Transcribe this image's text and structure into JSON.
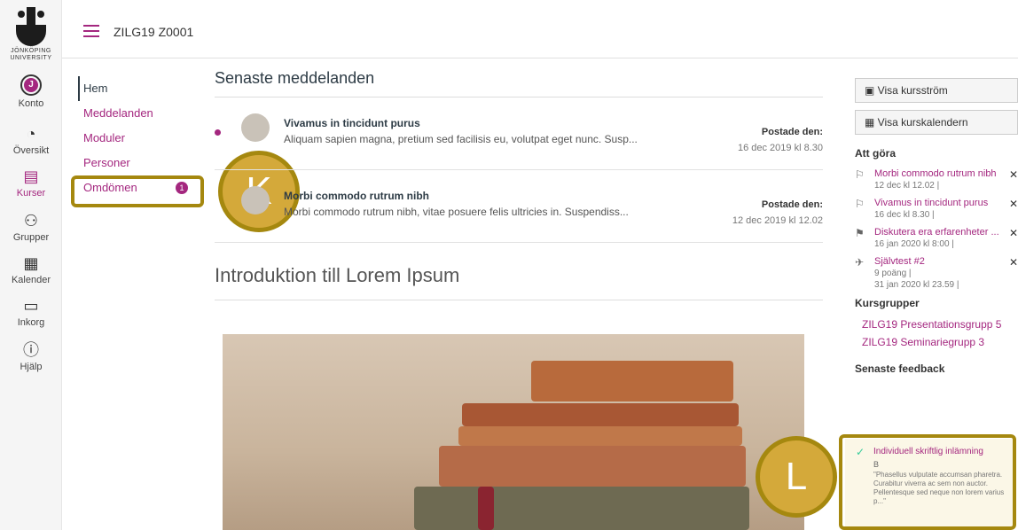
{
  "brand": {
    "logo_text": "JÖNKÖPING UNIVERSITY",
    "accent": "#a4277f",
    "highlight": "#a5880f"
  },
  "global_nav": [
    {
      "label": "Konto",
      "icon": "account-icon"
    },
    {
      "label": "Översikt",
      "icon": "dashboard-icon"
    },
    {
      "label": "Kurser",
      "icon": "courses-icon",
      "active": true
    },
    {
      "label": "Grupper",
      "icon": "groups-icon"
    },
    {
      "label": "Kalender",
      "icon": "calendar-icon"
    },
    {
      "label": "Inkorg",
      "icon": "inbox-icon"
    },
    {
      "label": "Hjälp",
      "icon": "help-icon"
    }
  ],
  "header": {
    "breadcrumb": "ZILG19 Z0001"
  },
  "course_nav": [
    {
      "label": "Hem",
      "active": true
    },
    {
      "label": "Meddelanden"
    },
    {
      "label": "Moduler"
    },
    {
      "label": "Personer"
    },
    {
      "label": "Omdömen",
      "badge": "1"
    }
  ],
  "callouts": {
    "k": "K",
    "l": "L"
  },
  "main": {
    "recent_heading": "Senaste meddelanden",
    "announcements": [
      {
        "title": "Vivamus in tincidunt purus",
        "snippet": "Aliquam sapien magna, pretium sed facilisis eu, volutpat eget nunc. Susp...",
        "posted_label": "Postade den:",
        "posted_date": "16 dec 2019 kl 8.30",
        "unread": true
      },
      {
        "title": "Morbi commodo rutrum nibh",
        "snippet": "Morbi commodo rutrum nibh, vitae posuere felis ultricies in. Suspendiss...",
        "posted_label": "Postade den:",
        "posted_date": "12 dec 2019 kl 12.02",
        "unread": false
      }
    ],
    "intro_heading": "Introduktion till Lorem Ipsum"
  },
  "sidebar": {
    "buttons": [
      "Visa kursström",
      "Visa kurskalendern"
    ],
    "todo_heading": "Att göra",
    "todo": [
      {
        "title": "Morbi commodo rutrum nibh",
        "meta": "12 dec kl 12.02  |"
      },
      {
        "title": "Vivamus in tincidunt purus",
        "meta": "16 dec kl 8.30  |"
      },
      {
        "title": "Diskutera era erfarenheter ...",
        "meta": "16 jan 2020 kl 8:00  |"
      },
      {
        "title": "Självtest #2",
        "meta": "9 poäng  |",
        "meta2": "31 jan 2020 kl 23.59  |"
      }
    ],
    "groups_heading": "Kursgrupper",
    "groups": [
      "ZILG19 Presentationsgrupp 5",
      "ZILG19 Seminariegrupp 3"
    ],
    "feedback_heading": "Senaste feedback",
    "feedback": {
      "title": "Individuell skriftlig inlämning",
      "grade": "B",
      "quote": "\"Phasellus vulputate accumsan pharetra. Curabitur viverra ac sem non auctor. Pellentesque sed neque non lorem varius p...\""
    }
  }
}
